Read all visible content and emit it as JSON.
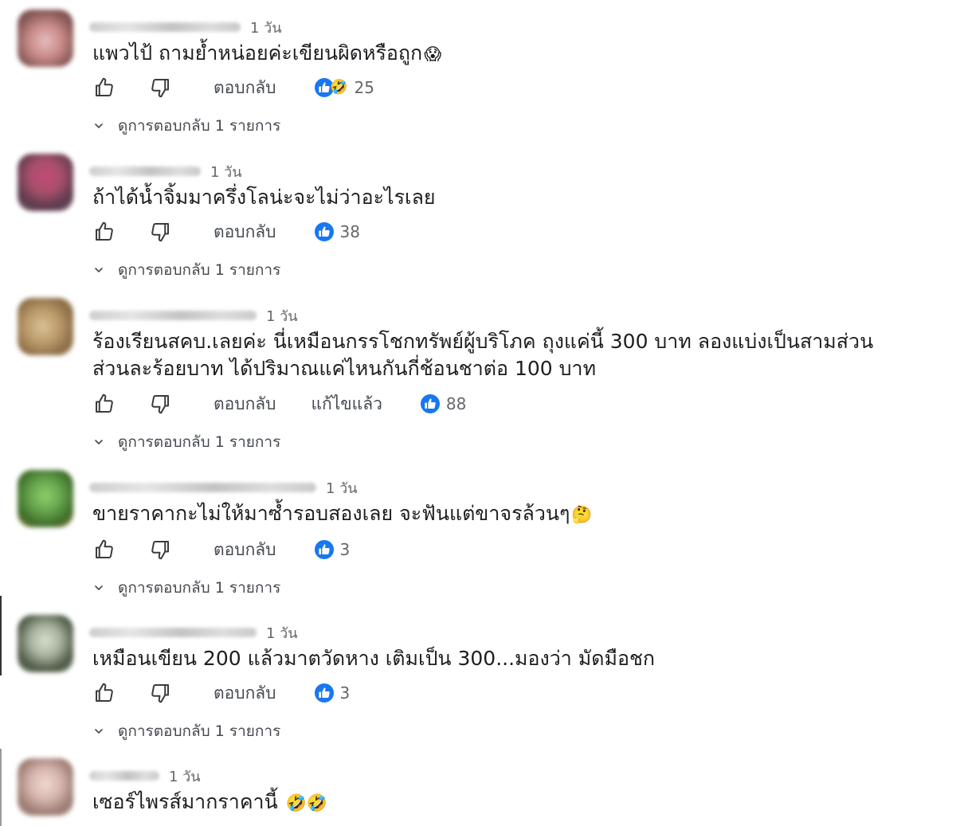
{
  "colors": {
    "like_blue": "#1877f2",
    "icon_gray": "#3a3b3c",
    "text_secondary": "#65676b"
  },
  "icons": {
    "like": "thumbs-up-outline",
    "dislike": "thumbs-down-outline",
    "reaction_like": "like-reaction-badge",
    "reaction_haha": "haha-reaction-emoji",
    "expand": "chevron-down"
  },
  "comments": [
    {
      "time": "1 วัน",
      "text": "แพวไป้ ถามย้ำหน่อยค่ะเขียนผิดหรือถูก",
      "emoji": "😱",
      "reply_label": "ตอบกลับ",
      "edited_label": "",
      "reaction_count": "25",
      "has_haha": true,
      "haha_emoji": "🤣",
      "view_replies": "ดูการตอบกลับ 1 รายการ",
      "avatar_colors": [
        "#e6bcbc",
        "#8a5a58"
      ]
    },
    {
      "time": "1 วัน",
      "text": "ถ้าได้น้ำจิ้มมาครึ่งโลน่ะจะไม่ว่าอะไรเลย",
      "emoji": "",
      "reply_label": "ตอบกลับ",
      "edited_label": "",
      "reaction_count": "38",
      "has_haha": false,
      "haha_emoji": "",
      "view_replies": "ดูการตอบกลับ 1 รายการ",
      "avatar_colors": [
        "#c44a78",
        "#5d3a4e"
      ]
    },
    {
      "time": "1 วัน",
      "text": "ร้องเรียนสคบ.เลยค่ะ นี่เหมือนกรรโชกทรัพย์ผู้บริโภค ถุงแค่นี้ 300 บาท ลองแบ่งเป็นสามส่วน ส่วนละร้อยบาท ได้ปริมาณแค่ไหนกันกี่ช้อนชาต่อ 100 บาท",
      "emoji": "",
      "reply_label": "ตอบกลับ",
      "edited_label": "แก้ไขแล้ว",
      "reaction_count": "88",
      "has_haha": false,
      "haha_emoji": "",
      "view_replies": "ดูการตอบกลับ 1 รายการ",
      "avatar_colors": [
        "#d9c196",
        "#8a6a44"
      ]
    },
    {
      "time": "1 วัน",
      "text": "ขายราคากะไม่ให้มาซ้ำรอบสองเลย จะฟันแต่ขาจรล้วนๆ",
      "emoji": "🤔",
      "reply_label": "ตอบกลับ",
      "edited_label": "",
      "reaction_count": "3",
      "has_haha": false,
      "haha_emoji": "",
      "view_replies": "ดูการตอบกลับ 1 รายการ",
      "avatar_colors": [
        "#6aa84f",
        "#3e6e2a"
      ]
    },
    {
      "time": "1 วัน",
      "text": "เหมือนเขียน 200 แล้วมาตวัดหาง เติมเป็น 300...มองว่า มัดมือชก",
      "emoji": "",
      "reply_label": "ตอบกลับ",
      "edited_label": "",
      "reaction_count": "3",
      "has_haha": false,
      "haha_emoji": "",
      "view_replies": "ดูการตอบกลับ 1 รายการ",
      "avatar_colors": [
        "#a9b5a0",
        "#4e5a46"
      ]
    },
    {
      "time": "1 วัน",
      "text": "เซอร์ไพรส์มากราคานี้",
      "emoji": "🤣🤣",
      "reply_label": "",
      "edited_label": "",
      "reaction_count": "",
      "has_haha": false,
      "haha_emoji": "",
      "view_replies": "",
      "avatar_colors": [
        "#d8b8b0",
        "#9a7a70"
      ]
    }
  ]
}
